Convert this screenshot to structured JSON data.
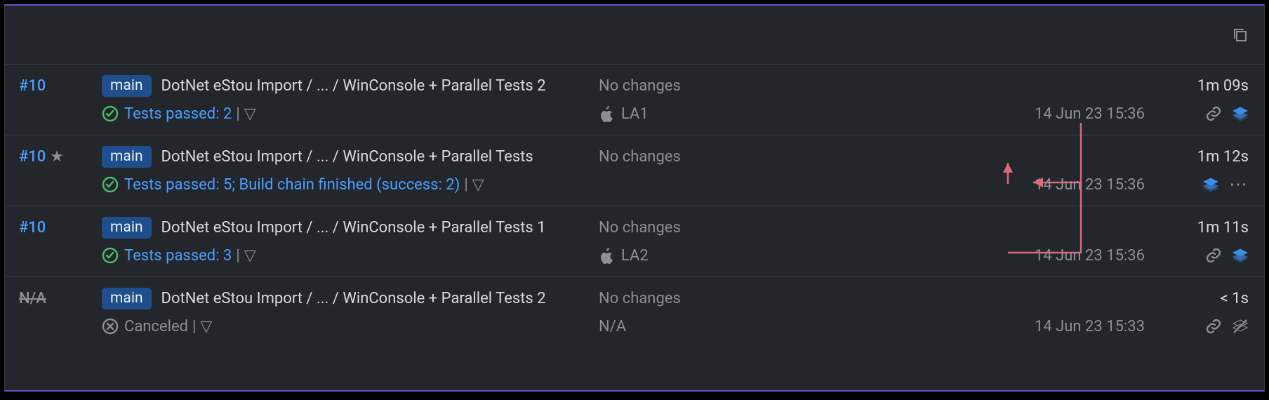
{
  "header": {},
  "builds": [
    {
      "id": "#10",
      "id_muted": false,
      "starred": false,
      "branch": "main",
      "path": "DotNet eStou Import / ... / WinConsole + Parallel Tests 2",
      "status_kind": "success",
      "status_text": "Tests passed: 2",
      "changes": "No changes",
      "agent": "LA1",
      "agent_kind": "apple",
      "datetime": "14 Jun 23 15:36",
      "duration": "1m 09s",
      "right_icons": [
        "link",
        "stack-blue"
      ]
    },
    {
      "id": "#10",
      "id_muted": false,
      "starred": true,
      "branch": "main",
      "path": "DotNet eStou Import / ... / WinConsole + Parallel Tests",
      "status_kind": "success",
      "status_text": "Tests passed: 5; Build chain finished (success: 2)",
      "changes": "No changes",
      "agent": "",
      "agent_kind": "",
      "datetime": "14 Jun 23 15:36",
      "duration": "1m 12s",
      "right_icons": [
        "stack-blue",
        "more"
      ]
    },
    {
      "id": "#10",
      "id_muted": false,
      "starred": false,
      "branch": "main",
      "path": "DotNet eStou Import / ... / WinConsole + Parallel Tests 1",
      "status_kind": "success",
      "status_text": "Tests passed: 3",
      "changes": "No changes",
      "agent": "LA2",
      "agent_kind": "apple",
      "datetime": "14 Jun 23 15:36",
      "duration": "1m 11s",
      "right_icons": [
        "link",
        "stack-blue"
      ]
    },
    {
      "id": "N/A",
      "id_muted": true,
      "starred": false,
      "branch": "main",
      "path": "DotNet eStou Import / ... / WinConsole + Parallel Tests 2",
      "status_kind": "canceled",
      "status_text": "Canceled",
      "changes": "No changes",
      "agent": "N/A",
      "agent_kind": "",
      "datetime": "14 Jun 23 15:33",
      "duration": "< 1s",
      "right_icons": [
        "link",
        "stack-grey"
      ]
    }
  ]
}
